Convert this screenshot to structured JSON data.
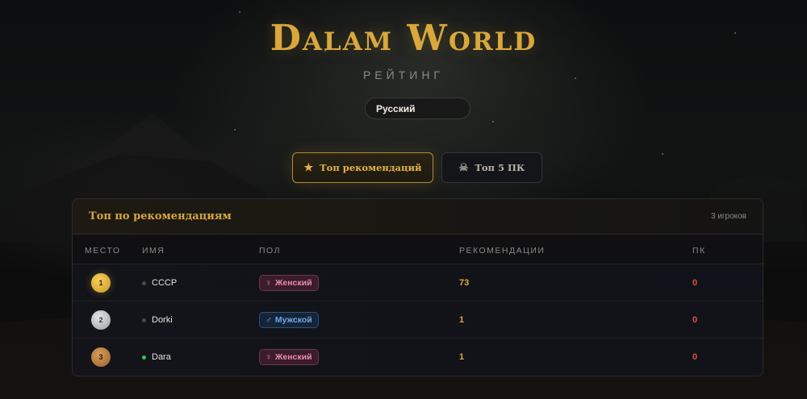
{
  "header": {
    "title": "Dalam World",
    "subtitle": "РЕЙТИНГ"
  },
  "language_select": {
    "selected": "Русский"
  },
  "tabs": [
    {
      "label": "Топ рекомендаций",
      "icon": "star-icon",
      "active": true
    },
    {
      "label": "Топ 5 ПК",
      "icon": "skull-icon",
      "active": false
    }
  ],
  "panel": {
    "title": "Топ по рекомендациям",
    "count": "3 игроков",
    "columns": [
      "МЕСТО",
      "ИМЯ",
      "ПОЛ",
      "РЕКОМЕНДАЦИИ",
      "ПК"
    ],
    "rows": [
      {
        "place": "1",
        "name": "СССР",
        "online": false,
        "gender": "Женский",
        "gender_icon": "♀",
        "recommendations": "73",
        "pk": "0"
      },
      {
        "place": "2",
        "name": "Dorki",
        "online": false,
        "gender": "Мужской",
        "gender_icon": "♂",
        "recommendations": "1",
        "pk": "0"
      },
      {
        "place": "3",
        "name": "Dara",
        "online": true,
        "gender": "Женский",
        "gender_icon": "♀",
        "recommendations": "1",
        "pk": "0"
      }
    ]
  },
  "colors": {
    "accent_gold": "#d9a73c",
    "female": "#ec8bb3",
    "male": "#6fa9e8",
    "pk_red": "#e0503f",
    "online_green": "#3fbf58"
  }
}
